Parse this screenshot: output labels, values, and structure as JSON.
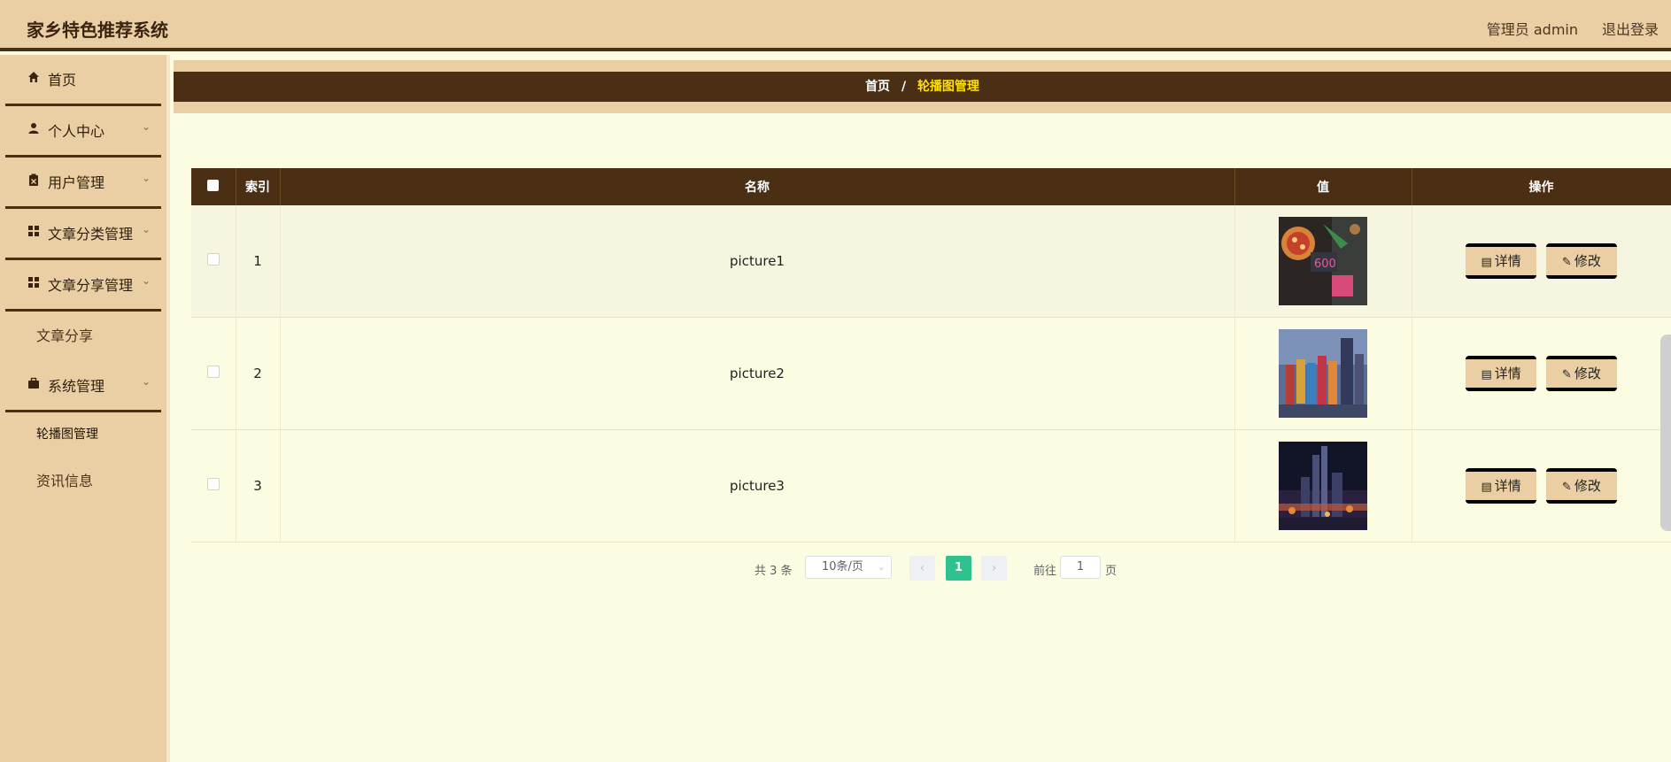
{
  "app": {
    "title": "家乡特色推荐系统",
    "admin_label": "管理员 admin",
    "logout_label": "退出登录"
  },
  "sidebar": {
    "items": [
      {
        "label": "首页",
        "icon": "home-icon"
      },
      {
        "label": "个人中心",
        "icon": "user-icon"
      },
      {
        "label": "用户管理",
        "icon": "clipboard-icon"
      },
      {
        "label": "文章分类管理",
        "icon": "grid-icon"
      },
      {
        "label": "文章分享管理",
        "icon": "grid-icon"
      },
      {
        "label": "系统管理",
        "icon": "briefcase-icon"
      }
    ],
    "sub_article_share": "文章分享",
    "sub_carousel": "轮播图管理",
    "sub_news": "资讯信息"
  },
  "breadcrumb": {
    "home": "首页",
    "separator": "/",
    "current": "轮播图管理"
  },
  "table": {
    "headers": {
      "index": "索引",
      "name": "名称",
      "value": "值",
      "actions": "操作"
    },
    "rows": [
      {
        "index": "1",
        "name": "picture1"
      },
      {
        "index": "2",
        "name": "picture2"
      },
      {
        "index": "3",
        "name": "picture3"
      }
    ],
    "detail_label": "详情",
    "edit_label": "修改"
  },
  "pagination": {
    "total": "共 3 条",
    "page_size": "10条/页",
    "current_page": "1",
    "goto_label": "前往",
    "goto_value": "1",
    "page_unit": "页"
  }
}
